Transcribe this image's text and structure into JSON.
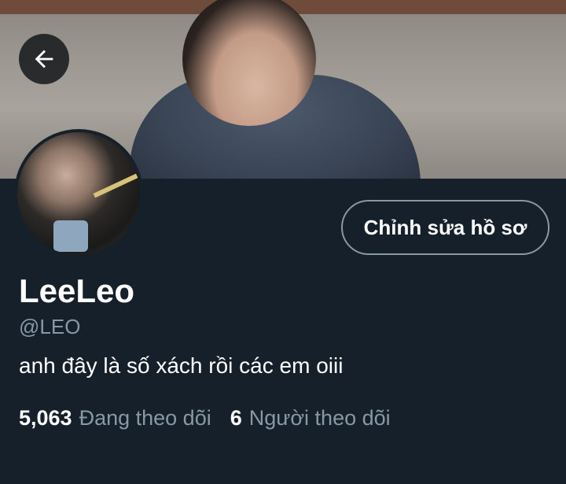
{
  "header": {
    "back_icon": "arrow-left-icon"
  },
  "profile": {
    "edit_button_label": "Chỉnh sửa hồ sơ",
    "display_name": "LeeLeo",
    "handle": "@LEO",
    "bio": "anh đây là số xách rồi các em oiii",
    "following_count": "5,063",
    "following_label": "Đang theo dõi",
    "followers_count": "6",
    "followers_label": "Người theo dõi"
  },
  "colors": {
    "background": "#15202b",
    "secondary_text": "#8899a6",
    "border": "#8899a6"
  }
}
